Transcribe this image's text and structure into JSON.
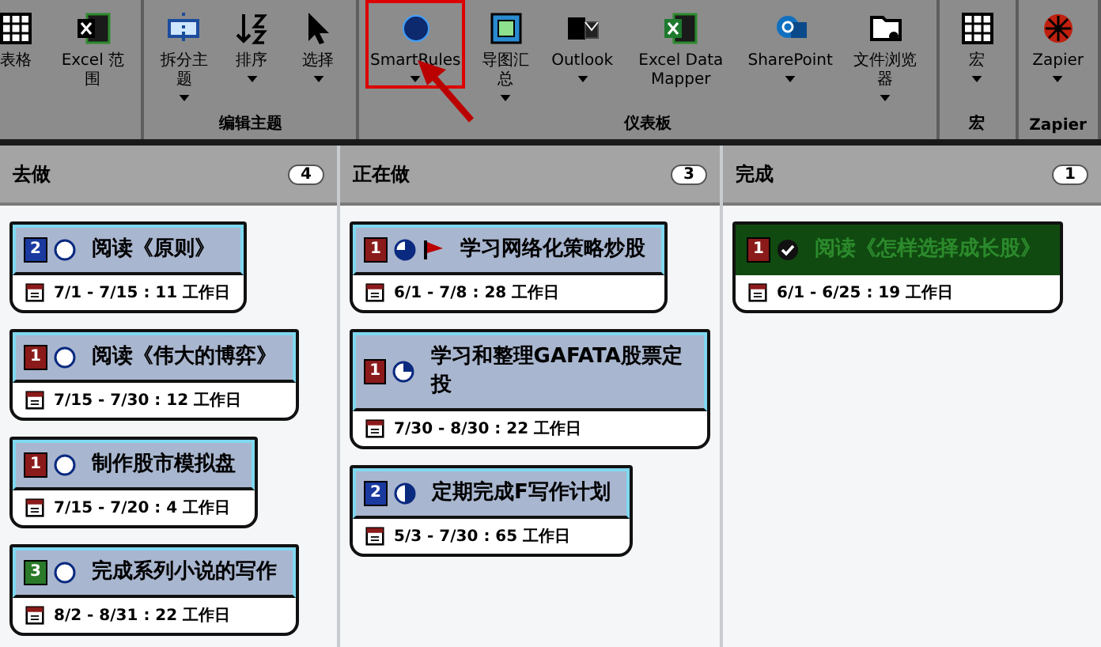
{
  "ribbon": {
    "groups": [
      {
        "buttons": [
          {
            "kind": "table",
            "label": "表格",
            "dropdown": false,
            "highlighted": false
          },
          {
            "kind": "excel",
            "label": "Excel 范围",
            "dropdown": false,
            "highlighted": false
          }
        ]
      },
      {
        "label": "编辑主题",
        "buttons": [
          {
            "kind": "split",
            "label": "拆分主题",
            "dropdown": true,
            "highlighted": false
          },
          {
            "kind": "sort",
            "label": "排序",
            "dropdown": true,
            "highlighted": false
          },
          {
            "kind": "select",
            "label": "选择",
            "dropdown": true,
            "highlighted": false
          }
        ]
      },
      {
        "label": "仪表板",
        "buttons": [
          {
            "kind": "smartrules",
            "label": "SmartRules",
            "dropdown": true,
            "highlighted": true
          },
          {
            "kind": "summary",
            "label": "导图汇总",
            "dropdown": true,
            "highlighted": false
          },
          {
            "kind": "outlook",
            "label": "Outlook",
            "dropdown": true,
            "highlighted": false
          },
          {
            "kind": "datamapper",
            "label": "Excel Data Mapper",
            "dropdown": false,
            "highlighted": false
          },
          {
            "kind": "sharepoint",
            "label": "SharePoint",
            "dropdown": true,
            "highlighted": false
          },
          {
            "kind": "browser",
            "label": "文件浏览器",
            "dropdown": true,
            "highlighted": false
          }
        ]
      },
      {
        "label": "宏",
        "buttons": [
          {
            "kind": "macro",
            "label": "宏",
            "dropdown": true,
            "highlighted": false
          }
        ]
      },
      {
        "label": "Zapier",
        "buttons": [
          {
            "kind": "zapier",
            "label": "Zapier",
            "dropdown": true,
            "highlighted": false
          }
        ]
      }
    ]
  },
  "board": {
    "columns": [
      {
        "title": "去做",
        "count": "4",
        "cards": [
          {
            "priority": "2",
            "color": "#1a3aa0",
            "kind": "none",
            "flag": false,
            "done": false,
            "title": "阅读《原则》",
            "dates": "7/1 - 7/15 : 11 工作日"
          },
          {
            "priority": "1",
            "color": "#8b1a1a",
            "kind": "none",
            "flag": false,
            "done": false,
            "title": "阅读《伟大的博弈》",
            "dates": "7/15 - 7/30 : 12 工作日"
          },
          {
            "priority": "1",
            "color": "#8b1a1a",
            "kind": "none",
            "flag": false,
            "done": false,
            "title": "制作股市模拟盘",
            "dates": "7/15 - 7/20 : 4 工作日"
          },
          {
            "priority": "3",
            "color": "#2a7a2a",
            "kind": "none",
            "flag": false,
            "done": false,
            "title": "完成系列小说的写作",
            "dates": "8/2 - 8/31 : 22 工作日"
          }
        ]
      },
      {
        "title": "正在做",
        "count": "3",
        "cards": [
          {
            "priority": "1",
            "color": "#8b1a1a",
            "kind": "three_quarters",
            "flag": true,
            "done": false,
            "title": "学习网络化策略炒股",
            "dates": "6/1 - 7/8 : 28 工作日"
          },
          {
            "priority": "1",
            "color": "#8b1a1a",
            "kind": "quarter",
            "flag": false,
            "done": false,
            "title": "学习和整理GAFATA股票定投",
            "dates": "7/30 - 8/30 : 22 工作日"
          },
          {
            "priority": "2",
            "color": "#1a3aa0",
            "kind": "half",
            "flag": false,
            "done": false,
            "title": "定期完成F写作计划",
            "dates": "5/3 - 7/30 : 65 工作日"
          }
        ]
      },
      {
        "title": "完成",
        "count": "1",
        "cards": [
          {
            "priority": "1",
            "color": "#8b1a1a",
            "kind": "complete",
            "flag": false,
            "done": true,
            "title": "阅读《怎样选择成长股》",
            "dates": "6/1 - 6/25 : 19 工作日"
          }
        ]
      }
    ]
  }
}
